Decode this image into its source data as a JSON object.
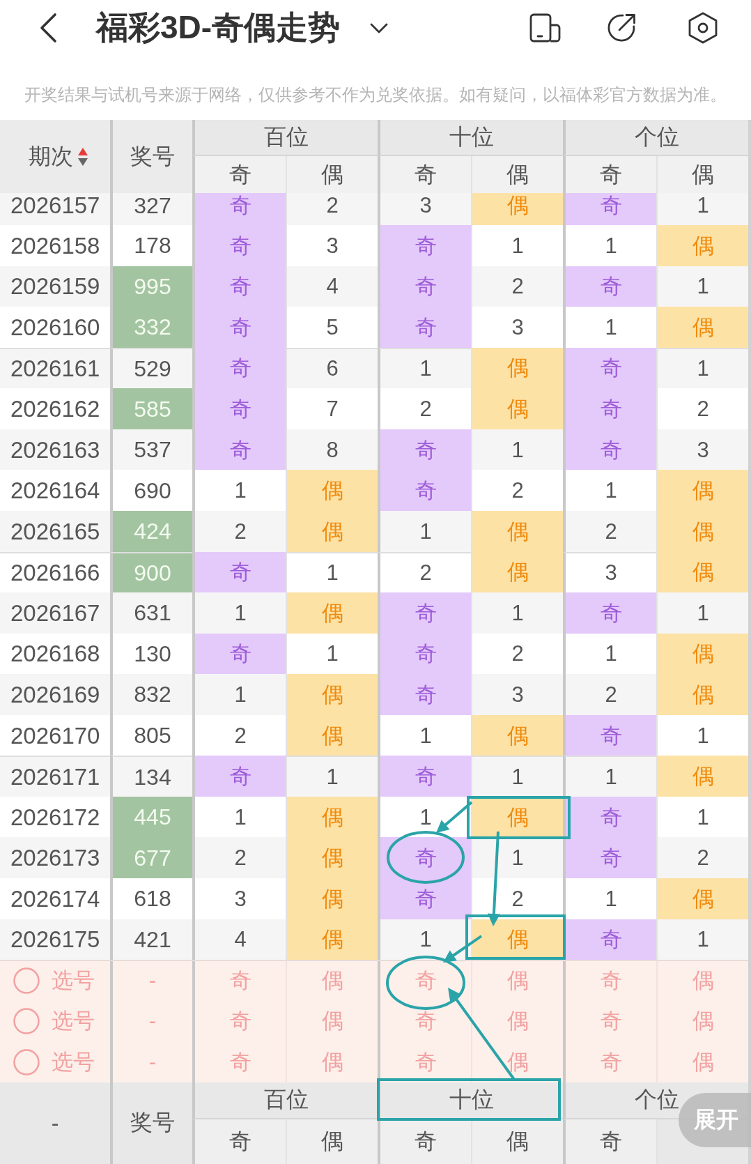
{
  "title_bar": {
    "title": "福彩3D-奇偶走势"
  },
  "notice": "开奖结果与试机号来源于网络，仅供参考不作为兑奖依据。如有疑问，以福体彩官方数据为准。",
  "table": {
    "header": {
      "period": "期次",
      "sorted_ascending": true,
      "number": "奖号",
      "groups": [
        {
          "label": "百位",
          "sub": [
            "奇",
            "偶"
          ]
        },
        {
          "label": "十位",
          "sub": [
            "奇",
            "偶"
          ]
        },
        {
          "label": "个位",
          "sub": [
            "奇",
            "偶"
          ]
        }
      ]
    },
    "rows": [
      {
        "period": "2026157",
        "number": "327",
        "highlighted": false,
        "cells": [
          {
            "text": "奇",
            "hit": true
          },
          {
            "text": "2",
            "hit": false
          },
          {
            "text": "3",
            "hit": false
          },
          {
            "text": "偶",
            "hit": true
          },
          {
            "text": "奇",
            "hit": true
          },
          {
            "text": "1",
            "hit": false
          }
        ]
      },
      {
        "period": "2026158",
        "number": "178",
        "highlighted": false,
        "cells": [
          {
            "text": "奇",
            "hit": true
          },
          {
            "text": "3",
            "hit": false
          },
          {
            "text": "奇",
            "hit": true
          },
          {
            "text": "1",
            "hit": false
          },
          {
            "text": "1",
            "hit": false
          },
          {
            "text": "偶",
            "hit": true
          }
        ]
      },
      {
        "period": "2026159",
        "number": "995",
        "highlighted": true,
        "cells": [
          {
            "text": "奇",
            "hit": true
          },
          {
            "text": "4",
            "hit": false
          },
          {
            "text": "奇",
            "hit": true
          },
          {
            "text": "2",
            "hit": false
          },
          {
            "text": "奇",
            "hit": true
          },
          {
            "text": "1",
            "hit": false
          }
        ]
      },
      {
        "period": "2026160",
        "number": "332",
        "highlighted": true,
        "cells": [
          {
            "text": "奇",
            "hit": true
          },
          {
            "text": "5",
            "hit": false
          },
          {
            "text": "奇",
            "hit": true
          },
          {
            "text": "3",
            "hit": false
          },
          {
            "text": "1",
            "hit": false
          },
          {
            "text": "偶",
            "hit": true
          }
        ]
      },
      {
        "period": "2026161",
        "number": "529",
        "highlighted": false,
        "cells": [
          {
            "text": "奇",
            "hit": true
          },
          {
            "text": "6",
            "hit": false
          },
          {
            "text": "1",
            "hit": false
          },
          {
            "text": "偶",
            "hit": true
          },
          {
            "text": "奇",
            "hit": true
          },
          {
            "text": "1",
            "hit": false
          }
        ]
      },
      {
        "period": "2026162",
        "number": "585",
        "highlighted": true,
        "cells": [
          {
            "text": "奇",
            "hit": true
          },
          {
            "text": "7",
            "hit": false
          },
          {
            "text": "2",
            "hit": false
          },
          {
            "text": "偶",
            "hit": true
          },
          {
            "text": "奇",
            "hit": true
          },
          {
            "text": "2",
            "hit": false
          }
        ]
      },
      {
        "period": "2026163",
        "number": "537",
        "highlighted": false,
        "cells": [
          {
            "text": "奇",
            "hit": true
          },
          {
            "text": "8",
            "hit": false
          },
          {
            "text": "奇",
            "hit": true
          },
          {
            "text": "1",
            "hit": false
          },
          {
            "text": "奇",
            "hit": true
          },
          {
            "text": "3",
            "hit": false
          }
        ]
      },
      {
        "period": "2026164",
        "number": "690",
        "highlighted": false,
        "cells": [
          {
            "text": "1",
            "hit": false
          },
          {
            "text": "偶",
            "hit": true
          },
          {
            "text": "奇",
            "hit": true
          },
          {
            "text": "2",
            "hit": false
          },
          {
            "text": "1",
            "hit": false
          },
          {
            "text": "偶",
            "hit": true
          }
        ]
      },
      {
        "period": "2026165",
        "number": "424",
        "highlighted": true,
        "cells": [
          {
            "text": "2",
            "hit": false
          },
          {
            "text": "偶",
            "hit": true
          },
          {
            "text": "1",
            "hit": false
          },
          {
            "text": "偶",
            "hit": true
          },
          {
            "text": "2",
            "hit": false
          },
          {
            "text": "偶",
            "hit": true
          }
        ]
      },
      {
        "period": "2026166",
        "number": "900",
        "highlighted": true,
        "cells": [
          {
            "text": "奇",
            "hit": true
          },
          {
            "text": "1",
            "hit": false
          },
          {
            "text": "2",
            "hit": false
          },
          {
            "text": "偶",
            "hit": true
          },
          {
            "text": "3",
            "hit": false
          },
          {
            "text": "偶",
            "hit": true
          }
        ]
      },
      {
        "period": "2026167",
        "number": "631",
        "highlighted": false,
        "cells": [
          {
            "text": "1",
            "hit": false
          },
          {
            "text": "偶",
            "hit": true
          },
          {
            "text": "奇",
            "hit": true
          },
          {
            "text": "1",
            "hit": false
          },
          {
            "text": "奇",
            "hit": true
          },
          {
            "text": "1",
            "hit": false
          }
        ]
      },
      {
        "period": "2026168",
        "number": "130",
        "highlighted": false,
        "cells": [
          {
            "text": "奇",
            "hit": true
          },
          {
            "text": "1",
            "hit": false
          },
          {
            "text": "奇",
            "hit": true
          },
          {
            "text": "2",
            "hit": false
          },
          {
            "text": "1",
            "hit": false
          },
          {
            "text": "偶",
            "hit": true
          }
        ]
      },
      {
        "period": "2026169",
        "number": "832",
        "highlighted": false,
        "cells": [
          {
            "text": "1",
            "hit": false
          },
          {
            "text": "偶",
            "hit": true
          },
          {
            "text": "奇",
            "hit": true
          },
          {
            "text": "3",
            "hit": false
          },
          {
            "text": "2",
            "hit": false
          },
          {
            "text": "偶",
            "hit": true
          }
        ]
      },
      {
        "period": "2026170",
        "number": "805",
        "highlighted": false,
        "cells": [
          {
            "text": "2",
            "hit": false
          },
          {
            "text": "偶",
            "hit": true
          },
          {
            "text": "1",
            "hit": false
          },
          {
            "text": "偶",
            "hit": true
          },
          {
            "text": "奇",
            "hit": true
          },
          {
            "text": "1",
            "hit": false
          }
        ]
      },
      {
        "period": "2026171",
        "number": "134",
        "highlighted": false,
        "cells": [
          {
            "text": "奇",
            "hit": true
          },
          {
            "text": "1",
            "hit": false
          },
          {
            "text": "奇",
            "hit": true
          },
          {
            "text": "1",
            "hit": false
          },
          {
            "text": "1",
            "hit": false
          },
          {
            "text": "偶",
            "hit": true
          }
        ]
      },
      {
        "period": "2026172",
        "number": "445",
        "highlighted": true,
        "cells": [
          {
            "text": "1",
            "hit": false
          },
          {
            "text": "偶",
            "hit": true
          },
          {
            "text": "1",
            "hit": false
          },
          {
            "text": "偶",
            "hit": true
          },
          {
            "text": "奇",
            "hit": true
          },
          {
            "text": "1",
            "hit": false
          }
        ]
      },
      {
        "period": "2026173",
        "number": "677",
        "highlighted": true,
        "cells": [
          {
            "text": "2",
            "hit": false
          },
          {
            "text": "偶",
            "hit": true
          },
          {
            "text": "奇",
            "hit": true
          },
          {
            "text": "1",
            "hit": false
          },
          {
            "text": "奇",
            "hit": true
          },
          {
            "text": "2",
            "hit": false
          }
        ]
      },
      {
        "period": "2026174",
        "number": "618",
        "highlighted": false,
        "cells": [
          {
            "text": "3",
            "hit": false
          },
          {
            "text": "偶",
            "hit": true
          },
          {
            "text": "奇",
            "hit": true
          },
          {
            "text": "2",
            "hit": false
          },
          {
            "text": "1",
            "hit": false
          },
          {
            "text": "偶",
            "hit": true
          }
        ]
      },
      {
        "period": "2026175",
        "number": "421",
        "highlighted": false,
        "cells": [
          {
            "text": "4",
            "hit": false
          },
          {
            "text": "偶",
            "hit": true
          },
          {
            "text": "1",
            "hit": false
          },
          {
            "text": "偶",
            "hit": true
          },
          {
            "text": "奇",
            "hit": true
          },
          {
            "text": "1",
            "hit": false
          }
        ]
      }
    ],
    "pick_rows": [
      {
        "selected": false,
        "label": "选号",
        "number": "-",
        "options": [
          "奇",
          "偶",
          "奇",
          "偶",
          "奇",
          "偶"
        ]
      },
      {
        "selected": false,
        "label": "选号",
        "number": "-",
        "options": [
          "奇",
          "偶",
          "奇",
          "偶",
          "奇",
          "偶"
        ]
      },
      {
        "selected": false,
        "label": "选号",
        "number": "-",
        "options": [
          "奇",
          "偶",
          "奇",
          "偶",
          "奇",
          "偶"
        ]
      }
    ],
    "footer": {
      "period": "-",
      "number": "奖号",
      "groups": [
        "百位",
        "十位",
        "个位"
      ],
      "sub": [
        "奇",
        "偶",
        "奇",
        "偶",
        "奇"
      ]
    }
  },
  "expand_button": {
    "label": "展开"
  }
}
